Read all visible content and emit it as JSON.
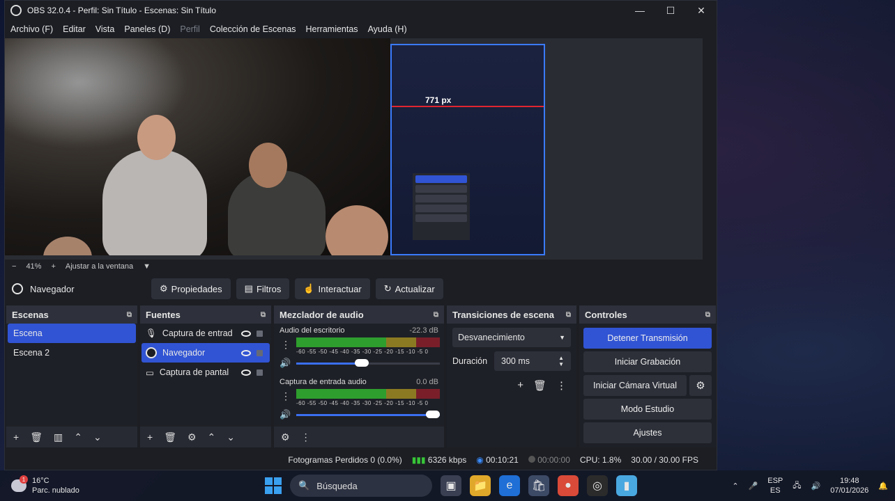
{
  "window": {
    "title": "OBS 32.0.4 - Perfil: Sin Título - Escenas: Sin Título",
    "minimize": "—",
    "maximize": "☐",
    "close": "✕"
  },
  "menu": {
    "items": [
      "Archivo (F)",
      "Editar",
      "Vista",
      "Paneles (D)",
      "Perfil",
      "Colección de Escenas",
      "Herramientas",
      "Ayuda (H)"
    ]
  },
  "preview": {
    "measure_label": "771 px",
    "zoom_minus": "−",
    "zoom_value": "41%",
    "zoom_plus": "+",
    "zoom_mode": "Ajustar a la ventana",
    "zoom_caret": "▼"
  },
  "source_toolbar": {
    "source_name": "Navegador",
    "properties": "Propiedades",
    "filters": "Filtros",
    "interact": "Interactuar",
    "refresh": "Actualizar"
  },
  "scenes": {
    "title": "Escenas",
    "items": [
      "Escena",
      "Escena 2"
    ],
    "selected_index": 0
  },
  "sources": {
    "title": "Fuentes",
    "items": [
      {
        "label": "Captura de entrad",
        "icon": "microphone-icon"
      },
      {
        "label": "Navegador",
        "icon": "globe-icon"
      },
      {
        "label": "Captura de pantal",
        "icon": "monitor-icon"
      }
    ],
    "selected_index": 1
  },
  "mixer": {
    "title": "Mezclador de audio",
    "scale": "-60 -55 -50 -45 -40 -35 -30 -25 -20 -15 -10 -5 0",
    "channels": [
      {
        "name": "Audio del escritorio",
        "db": "-22.3 dB",
        "volume": 0.45
      },
      {
        "name": "Captura de entrada audio",
        "db": "0.0 dB",
        "volume": 1.0
      }
    ]
  },
  "transitions": {
    "title": "Transiciones de escena",
    "selected": "Desvanecimiento",
    "duration_label": "Duración",
    "duration_value": "300 ms"
  },
  "controls": {
    "title": "Controles",
    "stop_stream": "Detener Transmisión",
    "start_recording": "Iniciar Grabación",
    "start_virtual_cam": "Iniciar Cámara Virtual",
    "studio_mode": "Modo Estudio",
    "settings": "Ajustes"
  },
  "status": {
    "dropped_frames": "Fotogramas Perdidos 0 (0.0%)",
    "bitrate": "6326 kbps",
    "stream_time": "00:10:21",
    "rec_time": "00:00:00",
    "cpu": "CPU: 1.8%",
    "fps": "30.00 / 30.00 FPS"
  },
  "taskbar": {
    "temperature": "16°C",
    "weather": "Parc. nublado",
    "weather_badge": "1",
    "search": "Búsqueda",
    "lang_top": "ESP",
    "lang_bottom": "ES",
    "time": "19:48",
    "date": "07/01/2026"
  },
  "colors": {
    "accent": "#3154d4",
    "meter_green": "#2e9e2e",
    "meter_yellow": "#8c7a22",
    "meter_red": "#7a1f2a",
    "measure_line": "#e0252f"
  }
}
